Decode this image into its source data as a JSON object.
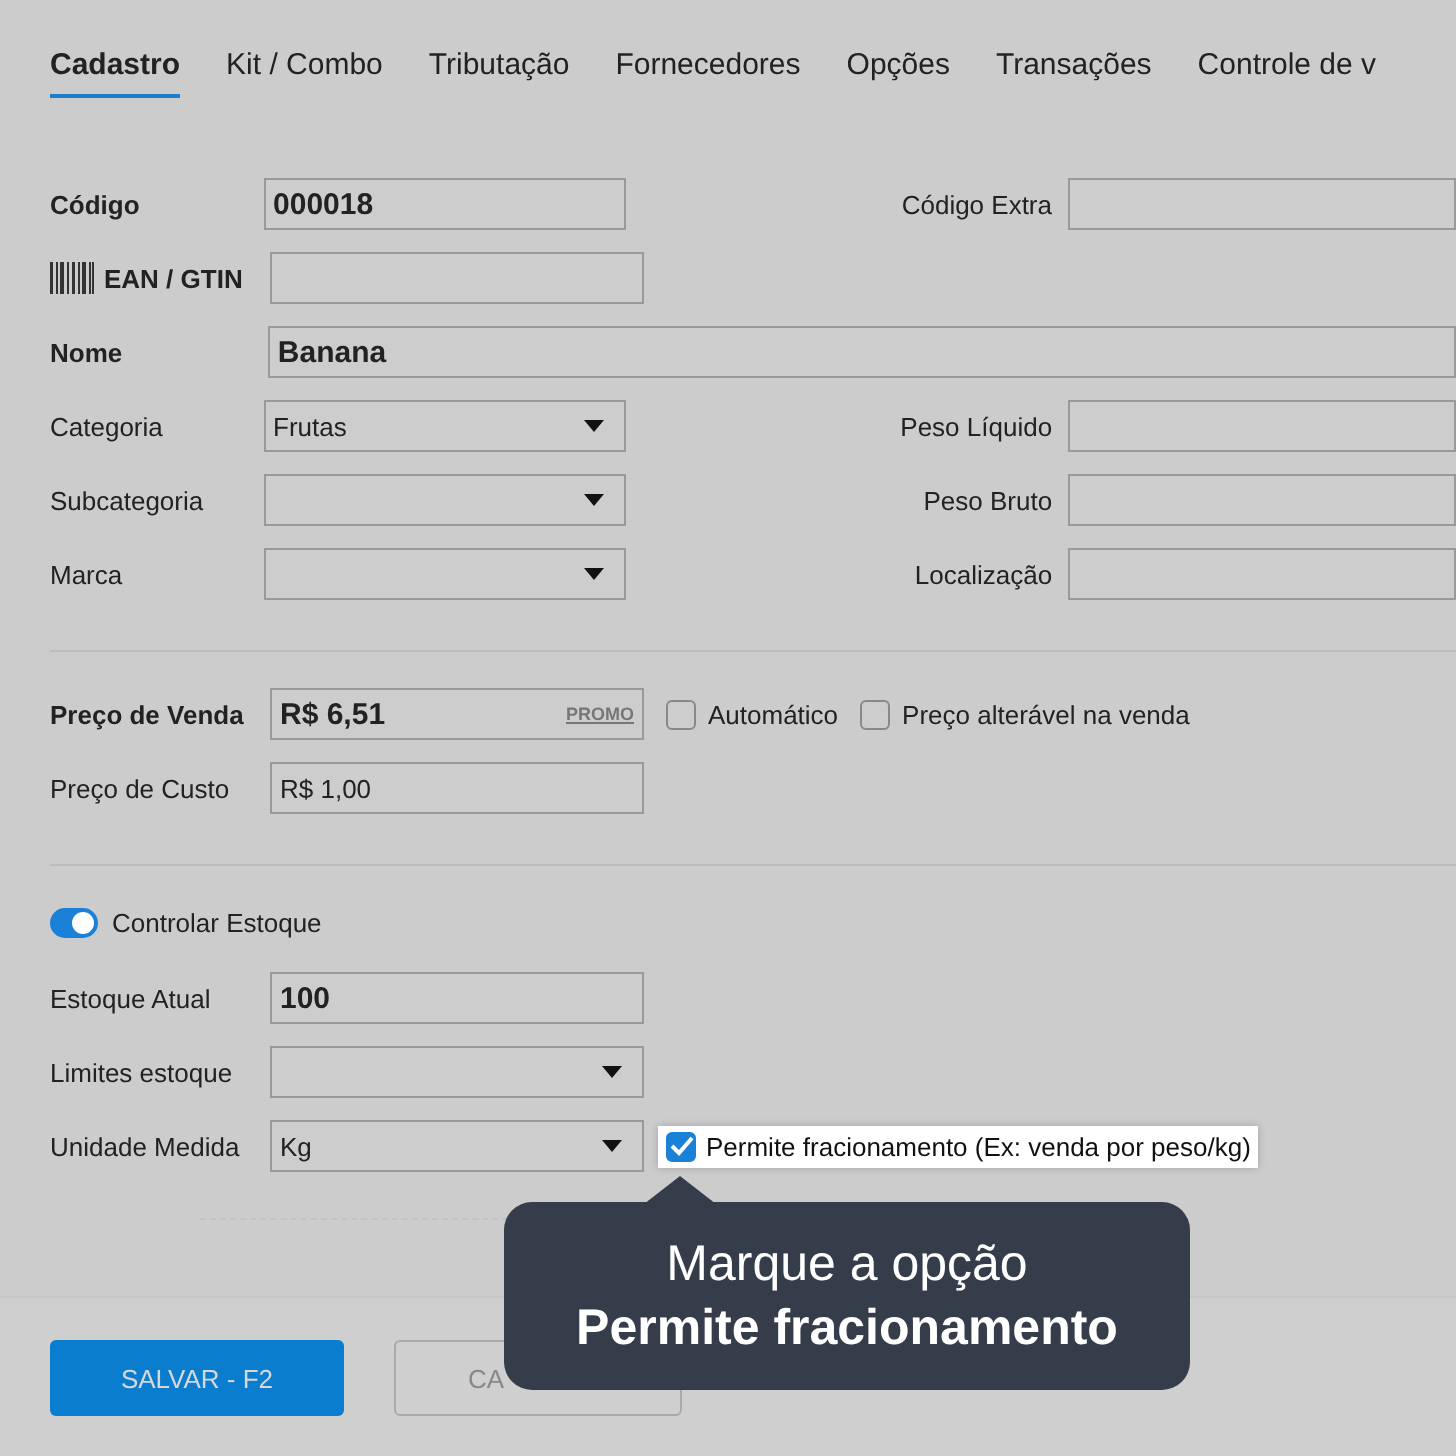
{
  "tabs": [
    {
      "label": "Cadastro",
      "selected": true
    },
    {
      "label": "Kit / Combo",
      "selected": false
    },
    {
      "label": "Tributação",
      "selected": false
    },
    {
      "label": "Fornecedores",
      "selected": false
    },
    {
      "label": "Opções",
      "selected": false
    },
    {
      "label": "Transações",
      "selected": false
    },
    {
      "label": "Controle de v",
      "selected": false
    }
  ],
  "identification": [
    {
      "kind": "text",
      "label": "Código",
      "strong": true,
      "value": "000018",
      "side": {
        "label": "Código Extra"
      }
    },
    {
      "kind": "barcode",
      "label": "EAN / GTIN",
      "strong": true
    },
    {
      "kind": "wide",
      "label": "Nome",
      "strong": true,
      "value": "Banana"
    },
    {
      "kind": "select",
      "label": "Categoria",
      "strong": false,
      "value": "Frutas",
      "side": {
        "label": "Peso Líquido"
      }
    },
    {
      "kind": "select",
      "label": "Subcategoria",
      "strong": false,
      "side": {
        "label": "Peso Bruto"
      }
    },
    {
      "kind": "select",
      "label": "Marca",
      "strong": false,
      "side": {
        "label": "Localização"
      }
    }
  ],
  "price": [
    {
      "label": "Preço de Venda",
      "strong": true,
      "value": "R$ 6,51",
      "promo": "PROMO",
      "options": [
        {
          "label": "Automático",
          "checked": false
        },
        {
          "label": "Preço alterável na venda",
          "checked": false
        }
      ]
    },
    {
      "label": "Preço de Custo",
      "strong": false,
      "value": "R$ 1,00"
    }
  ],
  "stock": {
    "toggle": {
      "label": "Controlar Estoque",
      "on": true
    },
    "rows": [
      {
        "kind": "text",
        "label": "Estoque Atual",
        "value": "100"
      },
      {
        "kind": "select",
        "label": "Limites estoque"
      },
      {
        "kind": "select",
        "label": "Unidade Medida",
        "value": "Kg"
      }
    ],
    "fraction": {
      "label": "Permite fracionamento (Ex: venda por peso/kg)",
      "checked": true
    }
  },
  "tooltip": {
    "text": "Marque a opção **Permite fracionamento**"
  },
  "buttons": [
    {
      "kind": "primary",
      "label": "SALVAR - F2"
    },
    {
      "kind": "secondary",
      "label": "CA"
    }
  ]
}
